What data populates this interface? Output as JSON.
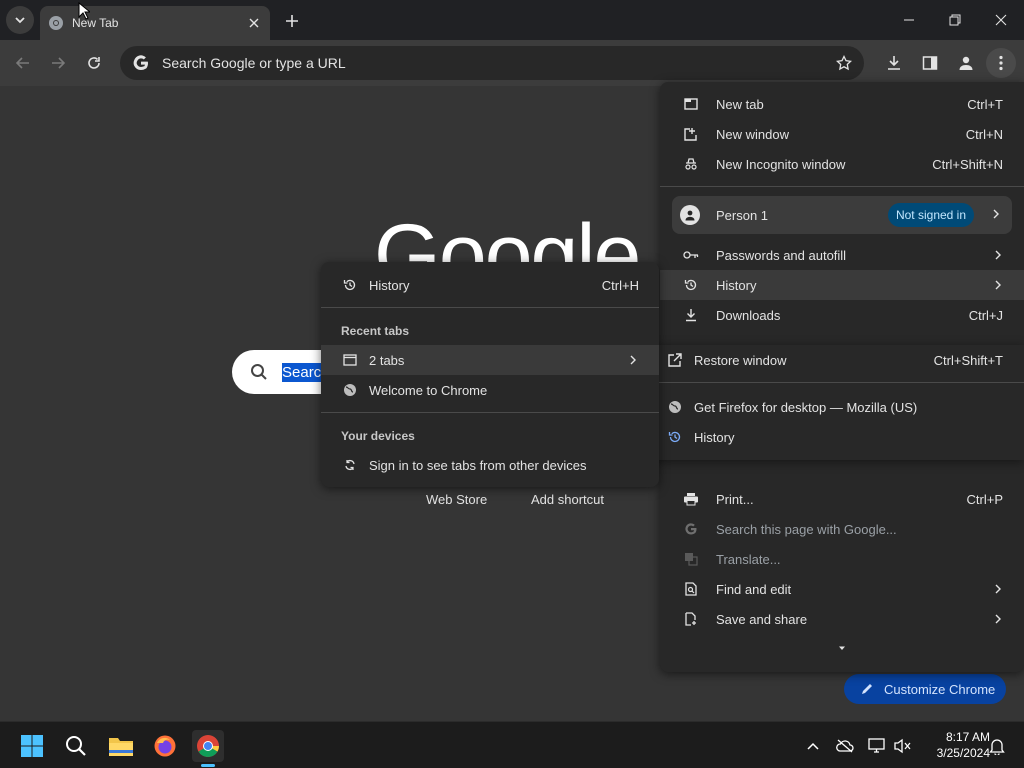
{
  "browser": {
    "tab_title": "New Tab",
    "omnibox_placeholder": "Search Google or type a URL"
  },
  "ntp": {
    "logo_text": "Google",
    "search_selected_text": "Searc",
    "shortcuts": [
      "Web Store",
      "Add shortcut"
    ],
    "customize_label": "Customize Chrome"
  },
  "main_menu": {
    "items_top": [
      {
        "label": "New tab",
        "shortcut": "Ctrl+T",
        "icon": "new-tab-icon"
      },
      {
        "label": "New window",
        "shortcut": "Ctrl+N",
        "icon": "new-window-icon"
      },
      {
        "label": "New Incognito window",
        "shortcut": "Ctrl+Shift+N",
        "icon": "incognito-icon"
      }
    ],
    "person": {
      "label": "Person 1",
      "badge": "Not signed in"
    },
    "items_mid": [
      {
        "label": "Passwords and autofill",
        "icon": "key-icon"
      },
      {
        "label": "History",
        "icon": "history-icon"
      },
      {
        "label": "Downloads",
        "shortcut": "Ctrl+J",
        "icon": "download-icon"
      }
    ],
    "overflow": [
      {
        "label": "Restore window",
        "shortcut": "Ctrl+Shift+T",
        "icon": "restore-icon"
      },
      {
        "label": "Get Firefox for desktop — Mozilla (US)",
        "icon": "globe-icon"
      },
      {
        "label": "History",
        "icon": "history-icon"
      }
    ],
    "items_bottom": [
      {
        "label": "Print...",
        "shortcut": "Ctrl+P",
        "icon": "print-icon"
      },
      {
        "label": "Search this page with Google...",
        "icon": "google-g-icon"
      },
      {
        "label": "Translate...",
        "icon": "translate-icon"
      },
      {
        "label": "Find and edit",
        "icon": "find-icon"
      },
      {
        "label": "Save and share",
        "icon": "save-share-icon"
      }
    ]
  },
  "history_submenu": {
    "history_label": "History",
    "history_shortcut": "Ctrl+H",
    "recent_tabs_title": "Recent tabs",
    "recent": [
      {
        "label": "2 tabs",
        "icon": "window-icon"
      },
      {
        "label": "Welcome to Chrome",
        "icon": "globe-icon"
      }
    ],
    "devices_title": "Your devices",
    "devices_item": "Sign in to see tabs from other devices"
  },
  "taskbar": {
    "time": "8:17 AM",
    "date": "3/25/2024"
  }
}
